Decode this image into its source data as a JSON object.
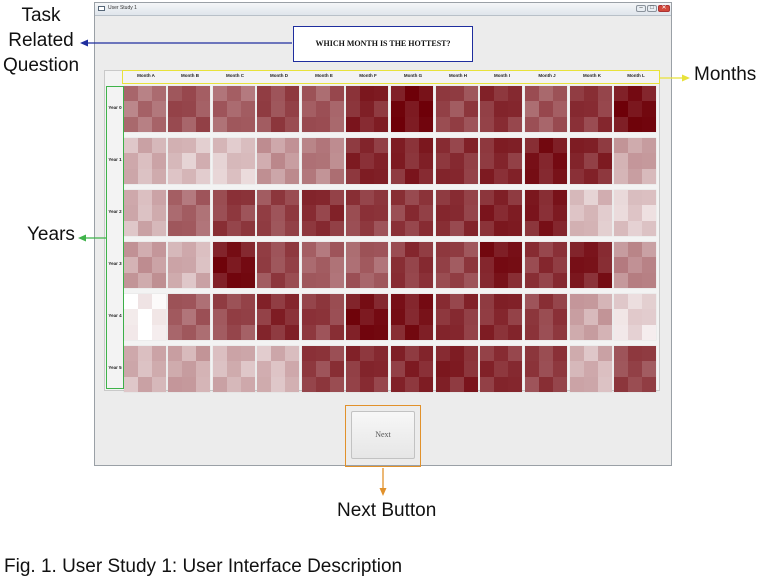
{
  "window": {
    "title": "User Study 1",
    "controls": [
      "–",
      "□",
      "✕"
    ]
  },
  "question": {
    "text": "WHICH MONTH IS THE HOTTEST?"
  },
  "months": [
    "Month A",
    "Month B",
    "Month C",
    "Month D",
    "Month E",
    "Month F",
    "Month G",
    "Month H",
    "Month I",
    "Month J",
    "Month K",
    "Month L"
  ],
  "years": [
    "Year 0",
    "Year 1",
    "Year 2",
    "Year 3",
    "Year 4",
    "Year 5"
  ],
  "heat_levels": [
    [
      0.55,
      0.68,
      0.6,
      0.72,
      0.65,
      0.85,
      0.95,
      0.72,
      0.8,
      0.65,
      0.78,
      0.93
    ],
    [
      0.3,
      0.25,
      0.22,
      0.4,
      0.5,
      0.83,
      0.85,
      0.8,
      0.83,
      0.9,
      0.83,
      0.35
    ],
    [
      0.3,
      0.6,
      0.75,
      0.72,
      0.8,
      0.75,
      0.77,
      0.79,
      0.85,
      0.87,
      0.25,
      0.2
    ],
    [
      0.38,
      0.3,
      0.92,
      0.72,
      0.6,
      0.62,
      0.78,
      0.72,
      0.9,
      0.78,
      0.88,
      0.45
    ],
    [
      0.04,
      0.62,
      0.7,
      0.82,
      0.75,
      0.92,
      0.9,
      0.8,
      0.82,
      0.75,
      0.35,
      0.15
    ],
    [
      0.3,
      0.35,
      0.3,
      0.28,
      0.75,
      0.8,
      0.83,
      0.85,
      0.8,
      0.75,
      0.3,
      0.72
    ]
  ],
  "next_button": {
    "label": "Next"
  },
  "annotations": {
    "question_label": [
      "Task",
      "Related",
      "Question"
    ],
    "months_label": "Months",
    "years_label": "Years",
    "next_label": "Next Button"
  },
  "caption": "Fig. 1. User Study 1: User Interface Description",
  "colors": {
    "question_box": "#1f2e9e",
    "months_box": "#e8e23a",
    "years_box": "#3fb34a",
    "next_box": "#e1912b",
    "heat_hot": "#6e0008",
    "heat_cold": "#ffffff"
  }
}
